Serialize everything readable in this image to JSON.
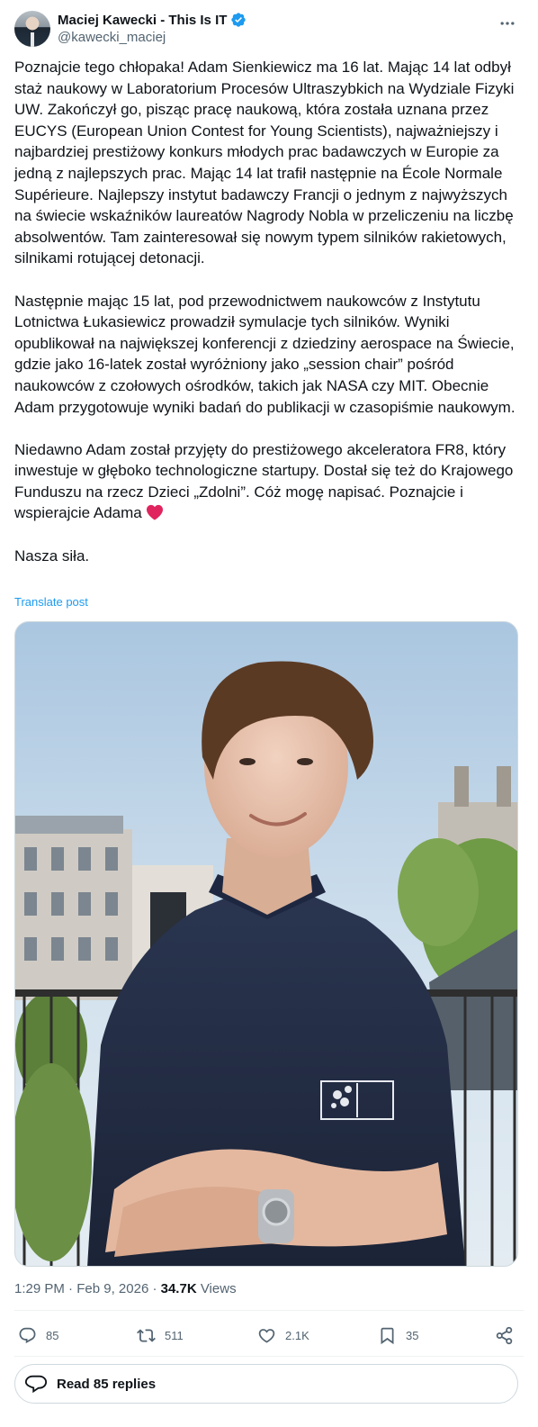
{
  "author": {
    "display_name": "Maciej Kawecki - This Is IT",
    "handle": "@kawecki_maciej",
    "verified_icon": "verified-badge-icon",
    "avatar_icon": "avatar"
  },
  "post": {
    "paragraphs": [
      "Poznajcie tego chłopaka! Adam Sienkiewicz ma 16 lat. Mając 14 lat odbył staż naukowy w Laboratorium Procesów Ultraszybkich na Wydziale Fizyki UW. Zakończył go, pisząc pracę naukową, która została uznana przez EUCYS (European Union Contest for Young Scientists), najważniejszy i najbardziej prestiżowy konkurs młodych prac badawczych w Europie za jedną z najlepszych prac. Mając 14 lat trafił następnie na École Normale Supérieure. Najlepszy instytut badawczy Francji o jednym z najwyższych na świecie wskaźników laureatów Nagrody Nobla w przeliczeniu na liczbę absolwentów. Tam zainteresował się nowym typem silników rakietowych, silnikami rotującej detonacji.",
      "Następnie mając 15 lat, pod przewodnictwem naukowców z Instytutu Lotnictwa Łukasiewicz prowadził symulacje tych silników. Wyniki opublikował na największej konferencji z dziedziny aerospace na Świecie, gdzie jako 16-latek został wyróżniony jako „session chair” pośród naukowców z czołowych ośrodków, takich jak NASA czy MIT. Obecnie Adam przygotowuje wyniki badań do publikacji w czasopiśmie naukowym.",
      "Niedawno Adam został przyjęty do prestiżowego akceleratora FR8, który inwestuje w głęboko technologiczne startupy. Dostał się też do Krajowego Funduszu na rzecz Dzieci „Zdolni”. Cóż mogę napisać. Poznajcie i wspierajcie Adama",
      "Nasza siła."
    ],
    "translate_label": "Translate post",
    "time": "1:29 PM",
    "date": "Feb 9, 2026",
    "views_count": "34.7K",
    "views_label": "Views"
  },
  "actions": {
    "replies": "85",
    "reposts": "511",
    "likes": "2.1K",
    "bookmarks": "35"
  },
  "replies_button": {
    "label": "Read 85 replies"
  },
  "colors": {
    "accent": "#1d9bf0",
    "text": "#0f1419",
    "muted": "#536471",
    "border": "#cfd9de",
    "heart": "#e0245e"
  }
}
